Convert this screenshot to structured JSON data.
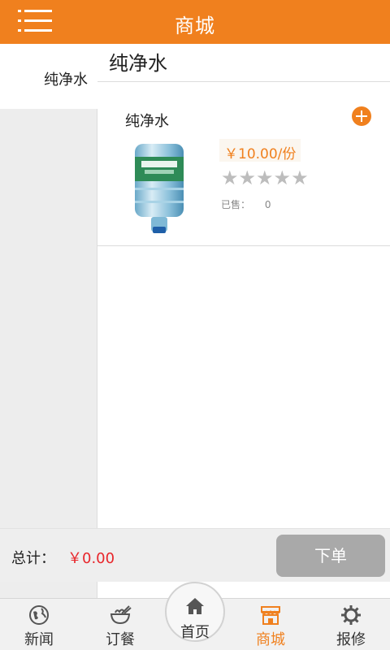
{
  "header": {
    "title": "商城",
    "menu_icon": "menu-icon"
  },
  "sidebar": {
    "items": [
      {
        "label": "纯净水",
        "selected": true
      }
    ]
  },
  "main": {
    "category_title": "纯净水",
    "products": [
      {
        "name": "纯净水",
        "image_icon": "water-bottle-image",
        "price": "￥10.00/份",
        "rating": 0,
        "rating_max": 5,
        "stars_text": "★★★★★",
        "sold_label": "已售：",
        "sold_count": "0",
        "add_icon": "plus-icon"
      }
    ]
  },
  "cart": {
    "total_label": "总计：",
    "total_value": "￥0.00",
    "order_button": "下单"
  },
  "tabs": [
    {
      "label": "新闻",
      "icon": "globe-icon"
    },
    {
      "label": "订餐",
      "icon": "bowl-icon"
    },
    {
      "label": "首页",
      "icon": "home-icon"
    },
    {
      "label": "商城",
      "icon": "shop-icon",
      "active": true
    },
    {
      "label": "报修",
      "icon": "gear-icon"
    }
  ],
  "colors": {
    "accent": "#f0801e",
    "price_red": "#e8262b",
    "order_button_bg": "#a9a9a9"
  }
}
